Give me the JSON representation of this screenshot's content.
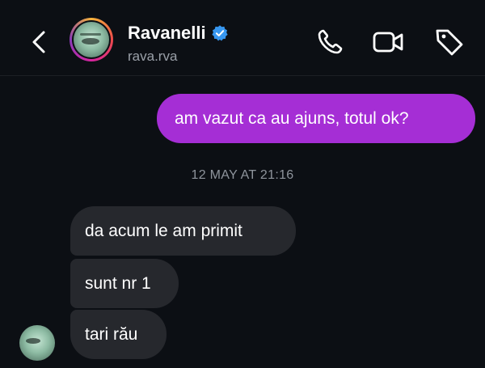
{
  "header": {
    "contact_name": "Ravanelli",
    "handle": "rava.rva",
    "verified": true,
    "icons": [
      "back-icon",
      "phone-icon",
      "video-camera-icon",
      "tag-icon",
      "verified-badge-icon"
    ]
  },
  "messages": {
    "outgoing": [
      {
        "text": "am vazut ca au ajuns, totul ok?"
      }
    ],
    "timestamp": "12 MAY AT 21:16",
    "incoming": [
      {
        "text": "da acum le am primit"
      },
      {
        "text": "sunt nr 1"
      },
      {
        "text": "tari rău"
      }
    ]
  },
  "colors": {
    "background": "#0c0f14",
    "outgoing_bubble": "#a52ed5",
    "incoming_bubble": "#26282d",
    "verified_badge": "#3797f0"
  }
}
